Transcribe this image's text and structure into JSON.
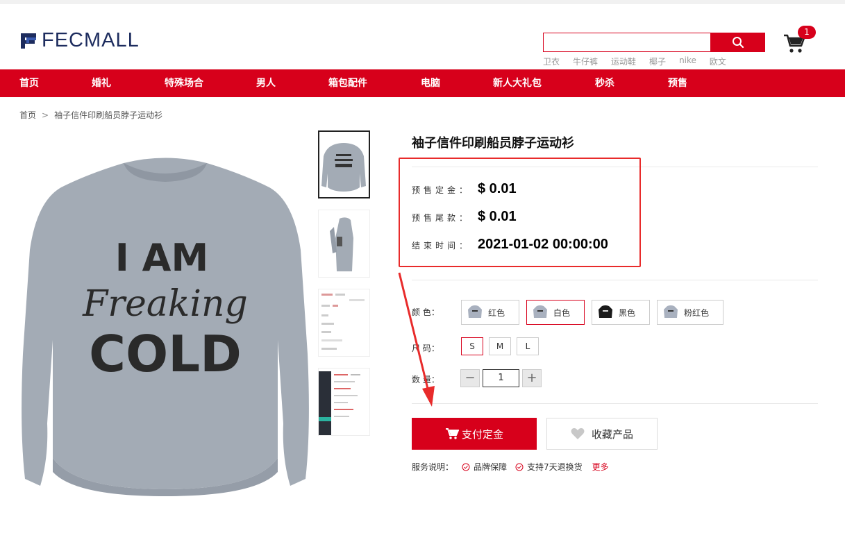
{
  "header": {
    "logo_text": "FECMALL",
    "search_placeholder": "",
    "hot_words": [
      "卫衣",
      "牛仔裤",
      "运动鞋",
      "椰子",
      "nike",
      "欧文"
    ],
    "cart_count": "1"
  },
  "nav": {
    "items": [
      "首页",
      "婚礼",
      "特殊场合",
      "男人",
      "箱包配件",
      "电脑",
      "新人大礼包",
      "秒杀",
      "预售"
    ]
  },
  "breadcrumb": {
    "home": "首页",
    "separator": ">",
    "current": "袖子信件印刷船员脖子运动衫"
  },
  "product": {
    "title": "袖子信件印刷船员脖子运动衫",
    "main_image_text": {
      "line1": "I AM",
      "line2": "Freaking",
      "line3": "COLD"
    },
    "presale": {
      "deposit_label": "预售定金：",
      "deposit_value": "$ 0.01",
      "balance_label": "预售尾款：",
      "balance_value": "$ 0.01",
      "end_label": "结束时间：",
      "end_value": "2021-01-02 00:00:00"
    },
    "color_label": "颜 色：",
    "colors": [
      {
        "name": "红色",
        "swatch": "#a9b1bf"
      },
      {
        "name": "白色",
        "swatch": "#a9b1bf"
      },
      {
        "name": "黑色",
        "swatch": "#1a1a1a"
      },
      {
        "name": "粉红色",
        "swatch": "#a9b1bf"
      }
    ],
    "size_label": "尺 码：",
    "sizes": [
      "S",
      "M",
      "L"
    ],
    "qty_label": "数 量：",
    "qty_minus": "−",
    "qty_plus": "+",
    "qty_value": "1",
    "pay_button": "支付定金",
    "fav_button": "收藏产品",
    "service_label": "服务说明：",
    "services": [
      "品牌保障",
      "支持7天退换货"
    ],
    "more": "更多"
  },
  "colors": {
    "brand_red": "#d7001b",
    "highlight_box": "#e82b2b",
    "logo_blue": "#1d2c5e"
  }
}
